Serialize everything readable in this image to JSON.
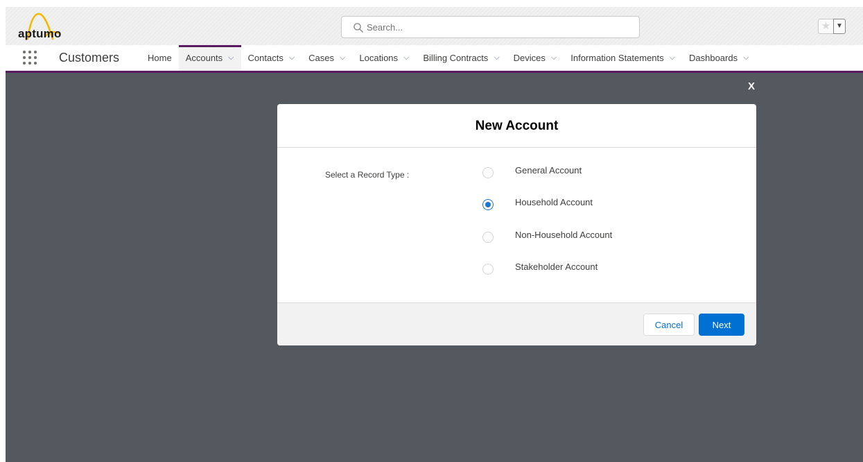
{
  "header": {
    "logo_text": "aptumo",
    "search": {
      "placeholder": "Search..."
    }
  },
  "nav": {
    "app_name": "Customers",
    "items": [
      {
        "label": "Home",
        "dropdown": false
      },
      {
        "label": "Accounts",
        "dropdown": true,
        "active": true
      },
      {
        "label": "Contacts",
        "dropdown": true
      },
      {
        "label": "Cases",
        "dropdown": true
      },
      {
        "label": "Locations",
        "dropdown": true
      },
      {
        "label": "Billing Contracts",
        "dropdown": true
      },
      {
        "label": "Devices",
        "dropdown": true
      },
      {
        "label": "Information Statements",
        "dropdown": true
      },
      {
        "label": "Dashboards",
        "dropdown": true
      }
    ]
  },
  "modal": {
    "close_label": "X",
    "title": "New Account",
    "record_type_label": "Select a Record Type :",
    "options": [
      {
        "label": "General Account",
        "checked": false
      },
      {
        "label": "Household Account",
        "checked": true
      },
      {
        "label": "Non-Household Account",
        "checked": false
      },
      {
        "label": "Stakeholder Account",
        "checked": false
      }
    ],
    "cancel_label": "Cancel",
    "next_label": "Next"
  },
  "colors": {
    "overlay": "#54585f",
    "brand": "#5a1a5f",
    "primary": "#0070d2",
    "radio_checked": "#1b76cf"
  },
  "icons": {
    "logo": "aptumo-arch-logo",
    "search": "search-icon",
    "favorite": "star-icon",
    "favorite_menu": "caret-down-icon",
    "launcher": "app-launcher-icon",
    "nav_dropdown": "chevron-down-icon",
    "close": "close-icon"
  }
}
